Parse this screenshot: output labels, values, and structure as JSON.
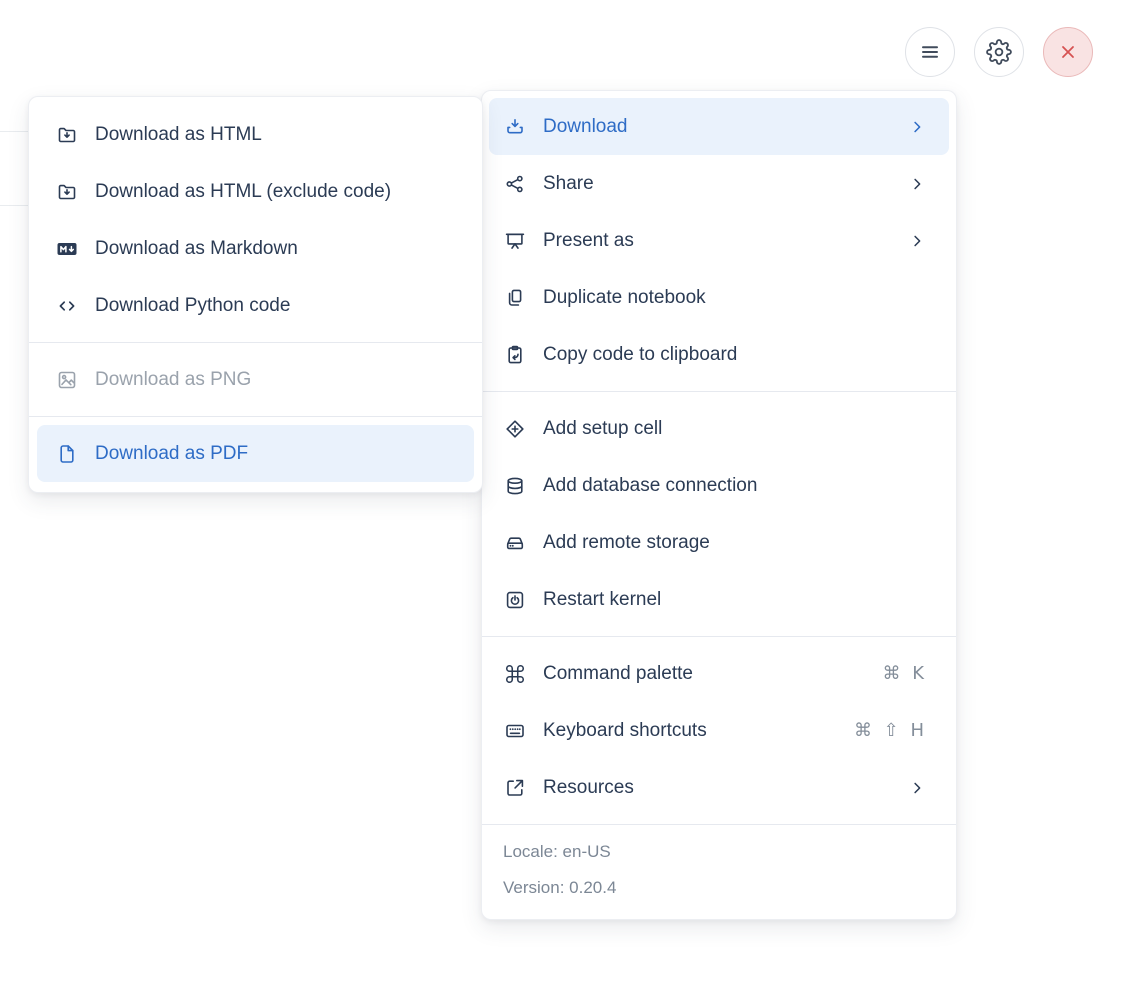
{
  "window": {
    "buttons": [
      {
        "name": "menu",
        "icon": "hamburger-icon"
      },
      {
        "name": "settings",
        "icon": "gear-icon"
      },
      {
        "name": "close",
        "icon": "close-icon"
      }
    ]
  },
  "main_menu": {
    "items": [
      {
        "label": "Download",
        "icon": "download-icon",
        "has_submenu": true,
        "state": "highlighted"
      },
      {
        "label": "Share",
        "icon": "share-icon",
        "has_submenu": true
      },
      {
        "label": "Present as",
        "icon": "presentation-icon",
        "has_submenu": true
      },
      {
        "label": "Duplicate notebook",
        "icon": "duplicate-icon"
      },
      {
        "label": "Copy code to clipboard",
        "icon": "clipboard-copy-icon"
      },
      {
        "label": "Add setup cell",
        "icon": "setup-cell-icon"
      },
      {
        "label": "Add database connection",
        "icon": "database-icon"
      },
      {
        "label": "Add remote storage",
        "icon": "storage-icon"
      },
      {
        "label": "Restart kernel",
        "icon": "restart-kernel-icon"
      },
      {
        "label": "Command palette",
        "icon": "command-icon",
        "shortcut": "⌘ K"
      },
      {
        "label": "Keyboard shortcuts",
        "icon": "keyboard-icon",
        "shortcut": "⌘ ⇧ H"
      },
      {
        "label": "Resources",
        "icon": "external-link-icon",
        "has_submenu": true
      }
    ],
    "footer": {
      "locale": "Locale: en-US",
      "version": "Version: 0.20.4"
    }
  },
  "download_submenu": {
    "items": [
      {
        "label": "Download as HTML",
        "icon": "folder-download-icon"
      },
      {
        "label": "Download as HTML (exclude code)",
        "icon": "folder-download-icon"
      },
      {
        "label": "Download as Markdown",
        "icon": "markdown-icon"
      },
      {
        "label": "Download Python code",
        "icon": "code-icon"
      },
      {
        "label": "Download as PNG",
        "icon": "image-icon",
        "state": "disabled"
      },
      {
        "label": "Download as PDF",
        "icon": "file-icon",
        "state": "highlighted"
      }
    ]
  },
  "colors": {
    "accent_blue": "#2e6cc6",
    "highlight_bg": "#eaf2fc",
    "text": "#2b3b54",
    "muted": "#7c8795",
    "divider": "#e6e9ef",
    "danger_red": "#d65252",
    "danger_bg": "#f9e3e3"
  }
}
